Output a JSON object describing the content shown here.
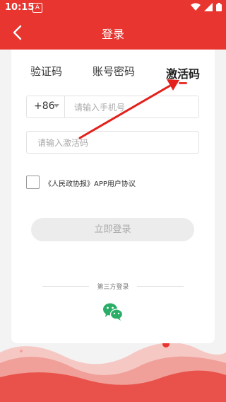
{
  "status_bar": {
    "time": "10:15",
    "notification_icon": "A"
  },
  "header": {
    "title": "登录"
  },
  "tabs": [
    {
      "label": "验证码",
      "active": false
    },
    {
      "label": "账号密码",
      "active": false
    },
    {
      "label": "激活码",
      "active": true
    }
  ],
  "phone": {
    "country_code": "+86",
    "placeholder": "请输入手机号"
  },
  "activation": {
    "placeholder": "请输入激活码"
  },
  "agreement": {
    "text": "《人民政协报》APP用户协议"
  },
  "login_button": {
    "label": "立即登录"
  },
  "third_party": {
    "label": "第三方登录",
    "icons": [
      "wechat-icon"
    ]
  },
  "colors": {
    "brand_red": "#e8352f",
    "disabled_button": "#ececec"
  }
}
